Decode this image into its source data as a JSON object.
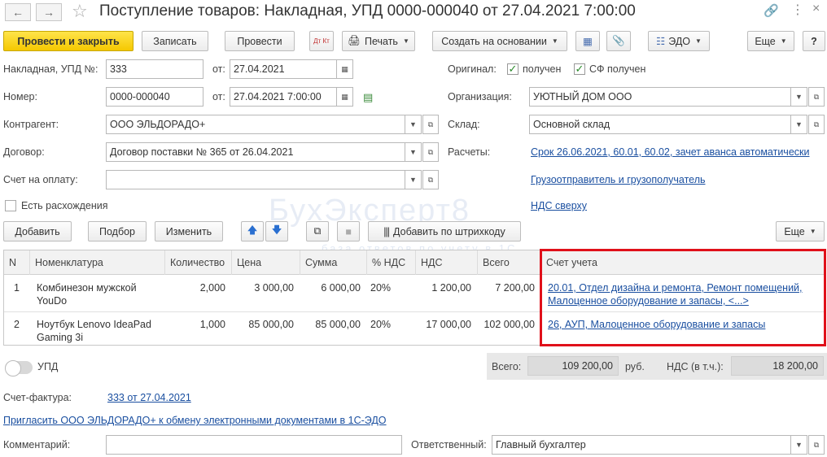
{
  "window": {
    "title": "Поступление товаров: Накладная, УПД 0000-000040 от 27.04.2021 7:00:00"
  },
  "toolbar": {
    "post_and_close": "Провести и закрыть",
    "save": "Записать",
    "post": "Провести",
    "dt_kt": "Дт Кт",
    "print": "Печать",
    "create_based_on": "Создать на основании",
    "edo": "ЭДО",
    "more": "Еще",
    "help": "?"
  },
  "form": {
    "invoice_label": "Накладная, УПД №:",
    "invoice_value": "333",
    "from_label": "от:",
    "invoice_date": "27.04.2021",
    "number_label": "Номер:",
    "number_value": "0000-000040",
    "datetime_value": "27.04.2021  7:00:00",
    "original_label": "Оригинал:",
    "received_label": "получен",
    "sf_received_label": "СФ получен",
    "organization_label": "Организация:",
    "organization_value": "УЮТНЫЙ ДОМ ООО",
    "counterparty_label": "Контрагент:",
    "counterparty_value": "ООО ЭЛЬДОРАДО+",
    "warehouse_label": "Склад:",
    "warehouse_value": "Основной склад",
    "contract_label": "Договор:",
    "contract_value": "Договор поставки № 365 от 26.04.2021",
    "settlements_label": "Расчеты:",
    "settlements_link": "Срок 26.06.2021, 60.01, 60.02, зачет аванса автоматически",
    "invoice_payment_label": "Счет на оплату:",
    "invoice_payment_value": "",
    "shipper_link": "Грузоотправитель и грузополучатель",
    "discrepancy_label": "Есть расхождения",
    "vat_link": "НДС сверху"
  },
  "table_toolbar": {
    "add": "Добавить",
    "select": "Подбор",
    "change": "Изменить",
    "add_barcode": "Добавить по штрихкоду",
    "more": "Еще"
  },
  "table": {
    "headers": [
      "N",
      "Номенклатура",
      "Количество",
      "Цена",
      "Сумма",
      "% НДС",
      "НДС",
      "Всего",
      "Счет учета"
    ],
    "rows": [
      {
        "n": "1",
        "item_line1": "Комбинезон мужской",
        "item_line2": "YouDo",
        "qty": "2,000",
        "price": "3 000,00",
        "sum": "6 000,00",
        "vat_rate": "20%",
        "vat": "1 200,00",
        "total": "7 200,00",
        "account_line1": "20.01, Отдел дизайна и ремонта, Ремонт помещений,",
        "account_line2": "Малоценное оборудование и запасы, <...>"
      },
      {
        "n": "2",
        "item_line1": "Ноутбук Lenovo IdeaPad",
        "item_line2": "Gaming 3i",
        "qty": "1,000",
        "price": "85 000,00",
        "sum": "85 000,00",
        "vat_rate": "20%",
        "vat": "17 000,00",
        "total": "102 000,00",
        "account_line1": "26, АУП, Малоценное оборудование и запасы",
        "account_line2": ""
      }
    ]
  },
  "footer": {
    "upd_label": "УПД",
    "total_label": "Всего:",
    "total_value": "109 200,00",
    "currency": "руб.",
    "vat_incl_label": "НДС (в т.ч.):",
    "vat_incl_value": "18 200,00",
    "sf_label": "Счет-фактура:",
    "sf_link": "333 от 27.04.2021",
    "invite_link": "Пригласить ООО ЭЛЬДОРАДО+ к обмену электронными документами в 1С-ЭДО",
    "comment_label": "Комментарий:",
    "comment_value": "",
    "responsible_label": "Ответственный:",
    "responsible_value": "Главный бухгалтер"
  },
  "watermark": {
    "line1": "БухЭксперт8",
    "line2": "база ответов по учету в 1С"
  },
  "colors": {
    "primary_button": "#f5c800",
    "link": "#1a4fa0",
    "highlight_box": "#e0101a",
    "checkbox_mark": "#2a8a2a"
  }
}
